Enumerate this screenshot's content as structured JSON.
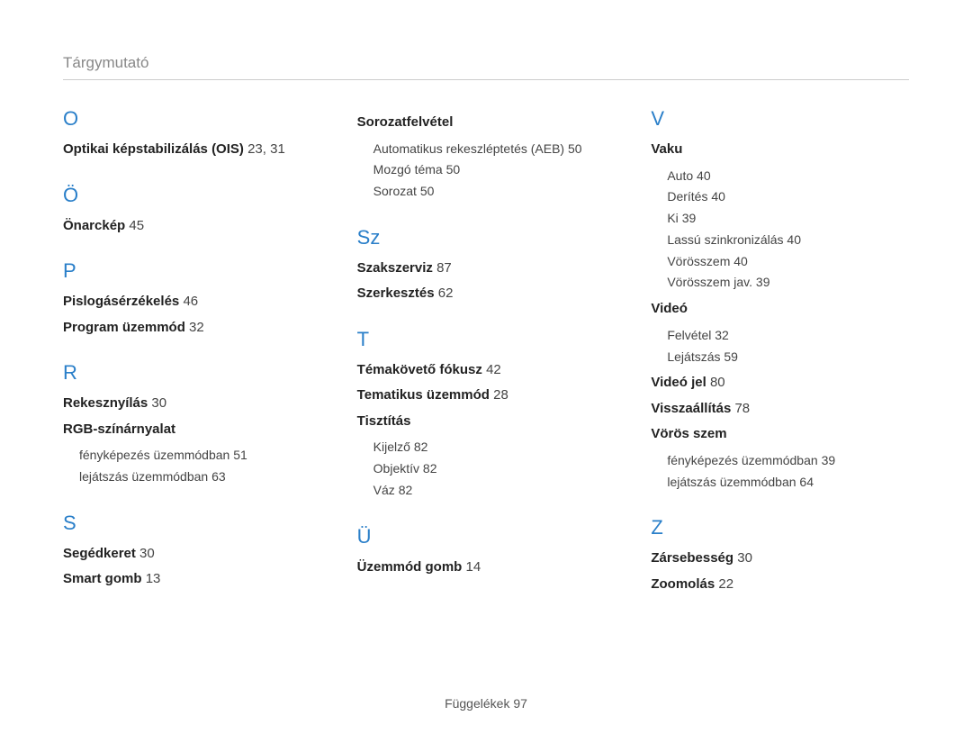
{
  "title": "Tárgymutató",
  "footer_label": "Függelékek",
  "footer_page": "97",
  "columns": [
    [
      {
        "type": "letter",
        "text": "O"
      },
      {
        "type": "main",
        "text": "Optikai képstabilizálás (OIS)",
        "pages": "23, 31"
      },
      {
        "type": "letter",
        "text": "Ö"
      },
      {
        "type": "main",
        "text": "Önarckép",
        "pages": "45"
      },
      {
        "type": "letter",
        "text": "P"
      },
      {
        "type": "main",
        "text": "Pislogásérzékelés",
        "pages": "46"
      },
      {
        "type": "main",
        "text": "Program üzemmód",
        "pages": "32"
      },
      {
        "type": "letter",
        "text": "R"
      },
      {
        "type": "main",
        "text": "Rekesznyílás",
        "pages": "30"
      },
      {
        "type": "main",
        "text": "RGB-színárnyalat",
        "pages": ""
      },
      {
        "type": "sub",
        "text": "fényképezés üzemmódban",
        "pages": "51"
      },
      {
        "type": "sub",
        "text": "lejátszás üzemmódban",
        "pages": "63"
      },
      {
        "type": "letter",
        "text": "S"
      },
      {
        "type": "main",
        "text": "Segédkeret",
        "pages": "30"
      },
      {
        "type": "main",
        "text": "Smart gomb",
        "pages": "13"
      }
    ],
    [
      {
        "type": "main",
        "text": "Sorozatfelvétel",
        "pages": ""
      },
      {
        "type": "sub",
        "text": "Automatikus rekeszléptetés (AEB)",
        "pages": "50"
      },
      {
        "type": "sub",
        "text": "Mozgó téma",
        "pages": "50"
      },
      {
        "type": "sub",
        "text": "Sorozat",
        "pages": "50"
      },
      {
        "type": "letter",
        "text": "Sz"
      },
      {
        "type": "main",
        "text": "Szakszerviz",
        "pages": "87"
      },
      {
        "type": "main",
        "text": "Szerkesztés",
        "pages": "62"
      },
      {
        "type": "letter",
        "text": "T"
      },
      {
        "type": "main",
        "text": "Témakövető fókusz",
        "pages": "42"
      },
      {
        "type": "main",
        "text": "Tematikus üzemmód",
        "pages": "28"
      },
      {
        "type": "main",
        "text": "Tisztítás",
        "pages": ""
      },
      {
        "type": "sub",
        "text": "Kijelző",
        "pages": "82"
      },
      {
        "type": "sub",
        "text": "Objektív",
        "pages": "82"
      },
      {
        "type": "sub",
        "text": "Váz",
        "pages": "82"
      },
      {
        "type": "letter",
        "text": "Ü"
      },
      {
        "type": "main",
        "text": "Üzemmód gomb",
        "pages": "14"
      }
    ],
    [
      {
        "type": "letter",
        "text": "V"
      },
      {
        "type": "main",
        "text": "Vaku",
        "pages": ""
      },
      {
        "type": "sub",
        "text": "Auto",
        "pages": "40"
      },
      {
        "type": "sub",
        "text": "Derítés",
        "pages": "40"
      },
      {
        "type": "sub",
        "text": "Ki",
        "pages": "39"
      },
      {
        "type": "sub",
        "text": "Lassú szinkronizálás",
        "pages": "40"
      },
      {
        "type": "sub",
        "text": "Vörösszem",
        "pages": "40"
      },
      {
        "type": "sub",
        "text": "Vörösszem jav.",
        "pages": "39"
      },
      {
        "type": "main",
        "text": "Videó",
        "pages": ""
      },
      {
        "type": "sub",
        "text": "Felvétel",
        "pages": "32"
      },
      {
        "type": "sub",
        "text": "Lejátszás",
        "pages": "59"
      },
      {
        "type": "main",
        "text": "Videó jel",
        "pages": "80"
      },
      {
        "type": "main",
        "text": "Visszaállítás",
        "pages": "78"
      },
      {
        "type": "main",
        "text": "Vörös szem",
        "pages": ""
      },
      {
        "type": "sub",
        "text": "fényképezés üzemmódban",
        "pages": "39"
      },
      {
        "type": "sub",
        "text": "lejátszás üzemmódban",
        "pages": "64"
      },
      {
        "type": "letter",
        "text": "Z"
      },
      {
        "type": "main",
        "text": "Zársebesség",
        "pages": "30"
      },
      {
        "type": "main",
        "text": "Zoomolás",
        "pages": "22"
      }
    ]
  ]
}
